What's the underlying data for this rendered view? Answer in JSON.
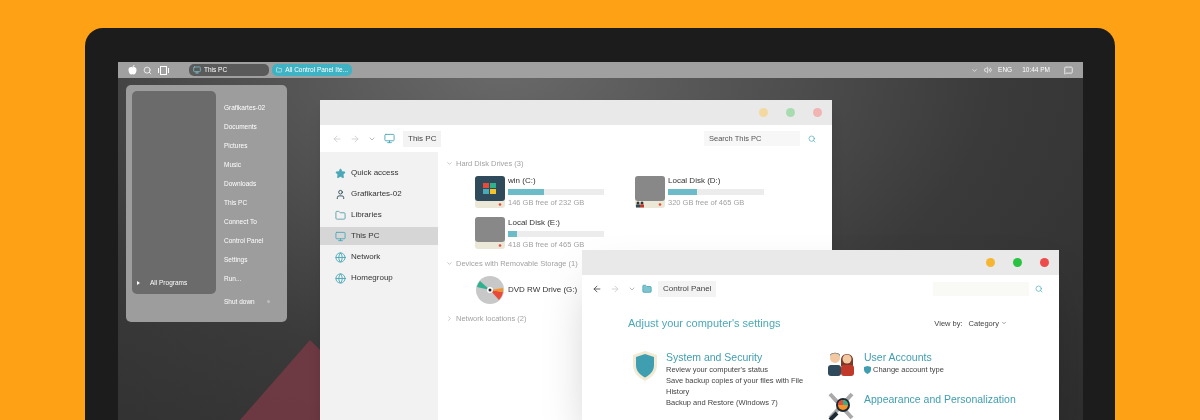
{
  "taskbar": {
    "tasks": [
      {
        "label": "This PC",
        "kind": "pc",
        "selected": false
      },
      {
        "label": "All Control Panel Ite...",
        "kind": "panel",
        "selected": true
      }
    ],
    "language": "ENG",
    "time": "10:44 PM"
  },
  "start_menu": {
    "all_programs": "All Programs",
    "items": [
      "Grafikartes-02",
      "Documents",
      "Pictures",
      "Music",
      "Downloads",
      "This PC",
      "Connect To",
      "Control Panel",
      "Settings",
      "Run..."
    ],
    "shutdown": "Shut down"
  },
  "explorer": {
    "active": false,
    "back_enabled": false,
    "address": "This PC",
    "search_placeholder": "Search This PC",
    "sidebar": [
      {
        "label": "Quick access",
        "kind": "star",
        "selected": false
      },
      {
        "label": "Grafikartes-02",
        "kind": "user",
        "selected": false
      },
      {
        "label": "Libraries",
        "kind": "folder",
        "selected": false
      },
      {
        "label": "This PC",
        "kind": "pc",
        "selected": true
      },
      {
        "label": "Network",
        "kind": "globe",
        "selected": false
      },
      {
        "label": "Homegroup",
        "kind": "globe",
        "selected": false
      }
    ],
    "groups": [
      {
        "label": "Hard Disk Drives (3)",
        "expanded": true,
        "drives": [
          {
            "name": "win (C:)",
            "kind": "system",
            "level": 0.37,
            "free": "146 GB free of 232 GB"
          },
          {
            "name": "Local Disk (D:)",
            "kind": "user-disk",
            "level": 0.3,
            "free": "320 GB free of 465 GB"
          },
          {
            "name": "Local Disk (E:)",
            "kind": "disk",
            "level": 0.09,
            "free": "418 GB free of 465 GB"
          }
        ]
      },
      {
        "label": "Devices with Removable Storage (1)",
        "expanded": true,
        "drives": [
          {
            "name": "DVD RW Drive (G:)",
            "kind": "dvd"
          }
        ]
      },
      {
        "label": "Network locations (2)",
        "expanded": false
      }
    ]
  },
  "control_panel": {
    "active": true,
    "back_enabled": true,
    "address": "Control Panel",
    "heading": "Adjust your computer's settings",
    "view_by_label": "View by:",
    "view_by_value": "Category",
    "categories": [
      {
        "title": "System and Security",
        "kind": "shield",
        "links": [
          {
            "text": "Review your computer's status",
            "shield": false
          },
          {
            "text": "Save backup copies of your files with File History",
            "shield": false
          },
          {
            "text": "Backup and Restore (Windows 7)",
            "shield": false
          }
        ]
      },
      {
        "title": "User Accounts",
        "kind": "users",
        "links": [
          {
            "text": "Change account type",
            "shield": true
          }
        ]
      },
      {
        "title": "Appearance and Personalization",
        "kind": "tools"
      }
    ]
  }
}
